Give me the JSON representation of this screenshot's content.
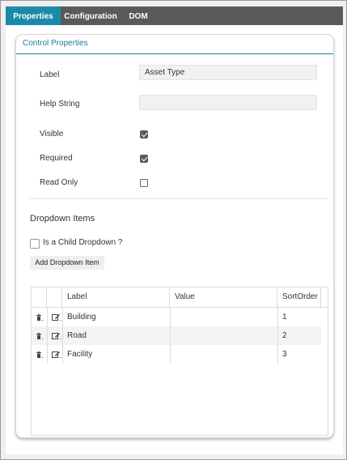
{
  "tabs": [
    {
      "label": "Properties",
      "active": true
    },
    {
      "label": "Configuration",
      "active": false
    },
    {
      "label": "DOM",
      "active": false
    }
  ],
  "panel": {
    "title": "Control Properties"
  },
  "properties": {
    "label_caption": "Label",
    "label_value": "Asset Type",
    "help_caption": "Help String",
    "help_value": "",
    "visible_caption": "Visible",
    "visible_checked": true,
    "required_caption": "Required",
    "required_checked": true,
    "readonly_caption": "Read Only",
    "readonly_checked": false
  },
  "dropdown": {
    "section_title": "Dropdown Items",
    "child_label": "Is a Child Dropdown ?",
    "child_checked": false,
    "add_button": "Add Dropdown Item"
  },
  "grid": {
    "columns": [
      "Label",
      "Value",
      "SortOrder"
    ],
    "rows": [
      {
        "label": "Building",
        "value": "",
        "sort": "1"
      },
      {
        "label": "Road",
        "value": "",
        "sort": "2"
      },
      {
        "label": "Facility",
        "value": "",
        "sort": "3"
      }
    ]
  },
  "colors": {
    "accent": "#1b8aa8",
    "tabbar": "#5a5a5a"
  },
  "icons": {
    "delete": "trash-icon",
    "edit": "edit-icon"
  }
}
